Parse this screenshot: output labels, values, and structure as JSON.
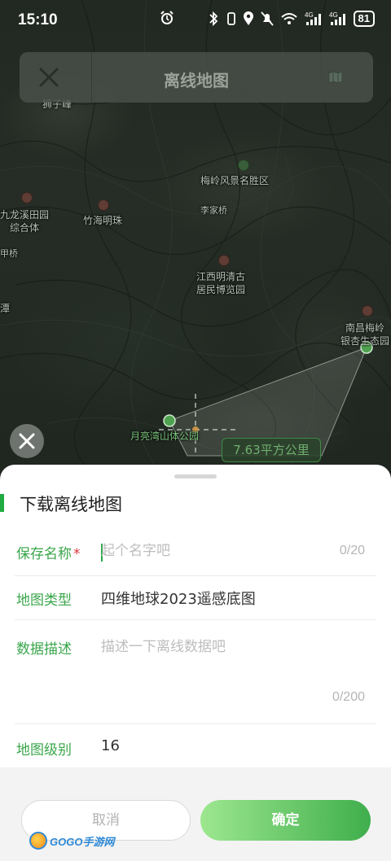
{
  "status_bar": {
    "time": "15:10",
    "battery": "81",
    "icons": [
      "alarm-icon",
      "bluetooth-icon",
      "vibrate-icon",
      "location-icon",
      "mute-icon",
      "wifi-icon",
      "signal-4g-icon",
      "signal-4g-icon",
      "battery-icon"
    ]
  },
  "header": {
    "title": "离线地图",
    "close_icon": "close-icon",
    "layer_icon": "map-layer-icon"
  },
  "map": {
    "labels": {
      "shizifeng": "狮子峰",
      "meiling_park": "梅岭风景名胜区",
      "jiulongxi": "九龙溪田园",
      "jiulongxi2": "综合体",
      "zhuhai": "竹海明珠",
      "lijiaqiao": "李家桥",
      "jiangxi_museum": "江西明清古",
      "jiangxi_museum2": "居民博览园",
      "nanchang": "南昌梅岭",
      "nanchang2": "银杏生态园",
      "yueliangwan": "月亮湾山体公园",
      "left_edge1": "甲桥",
      "left_edge2": "潭"
    },
    "area_measure": "7.63平方公里"
  },
  "sheet": {
    "title": "下载离线地图",
    "fields": {
      "name": {
        "label": "保存名称",
        "required_mark": "*",
        "placeholder": "起个名字吧",
        "value": "",
        "counter": "0/20"
      },
      "type": {
        "label": "地图类型",
        "value": "四维地球2023遥感底图"
      },
      "desc": {
        "label": "数据描述",
        "placeholder": "描述一下离线数据吧",
        "value": "",
        "counter": "0/200"
      },
      "level": {
        "label": "地图级别",
        "value": "16"
      }
    },
    "buttons": {
      "cancel": "取消",
      "confirm": "确定"
    }
  },
  "watermark": {
    "text": "GOGO手游网"
  },
  "colors": {
    "accent": "#3aa64b",
    "required": "#e0333a",
    "confirm_start": "#9de78f",
    "confirm_end": "#3fae4c"
  }
}
